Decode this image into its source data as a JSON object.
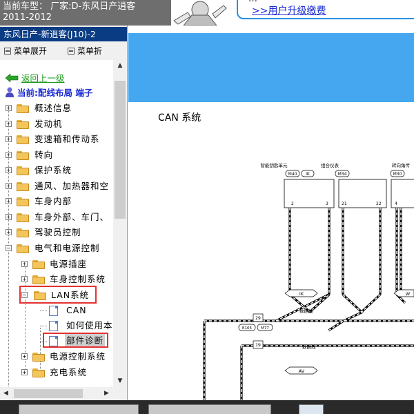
{
  "header": {
    "vehicle_line1": "当前车型：  厂家:D-东风日产逍客",
    "vehicle_line2": "2011-2012",
    "upgrade_text": "…",
    "upgrade_link": ">>用户升级缴费"
  },
  "sidebar": {
    "model_title": "东风日产-新逍客(J10)-2",
    "menu_expand": "菜单展开",
    "menu_collapse": "菜单折",
    "back_link": "返回上一级",
    "current": "当前:配线布局 端子",
    "tree": [
      {
        "label": "概述信息"
      },
      {
        "label": "发动机"
      },
      {
        "label": "变速箱和传动系"
      },
      {
        "label": "转向"
      },
      {
        "label": "保护系统"
      },
      {
        "label": "通风、加热器和空"
      },
      {
        "label": "车身内部"
      },
      {
        "label": "车身外部、车门、"
      },
      {
        "label": "驾驶员控制"
      },
      {
        "label": "电气和电源控制"
      }
    ],
    "subtree": [
      {
        "label": "电源插座"
      },
      {
        "label": "车身控制系统"
      },
      {
        "label": "LAN系统"
      }
    ],
    "lan_children": [
      {
        "label": "CAN"
      },
      {
        "label": "如何使用本"
      },
      {
        "label": "部件诊断"
      }
    ],
    "after": [
      {
        "label": "电源控制系统"
      },
      {
        "label": "充电系统"
      }
    ],
    "colors": {
      "title_bg": "#0a3c84",
      "selection": "#e53030",
      "back_link": "#1a9a1a",
      "current": "#1a2bd6"
    }
  },
  "main": {
    "band_color": "#44a7f0",
    "diagram_title": "CAN 系统",
    "diagram": {
      "units": [
        "智能钥匙单元",
        "组合仪表",
        "转向角传"
      ],
      "connectors": [
        "M40",
        "IK",
        "M34",
        "M30"
      ],
      "pins": [
        "2",
        "3",
        "21",
        "22",
        "4"
      ],
      "junctions": [
        "29",
        "19"
      ],
      "junction_codes": [
        "E105",
        "M77"
      ],
      "labels": [
        "IK",
        "AV",
        "数据线",
        "数据线",
        "W"
      ]
    }
  }
}
